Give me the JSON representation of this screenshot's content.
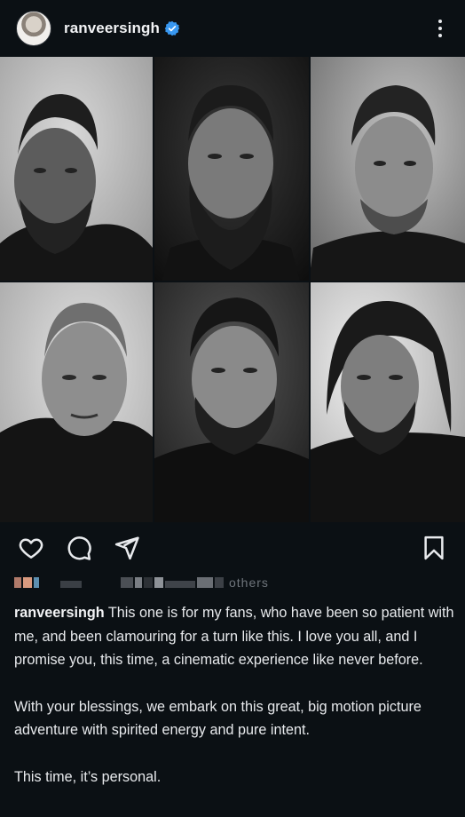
{
  "header": {
    "username": "ranveersingh",
    "verified": true,
    "icons": [
      "avatar",
      "verified-badge-icon",
      "more-options-icon"
    ]
  },
  "grid": {
    "tiles": 6,
    "tone": "black-and-white portraits"
  },
  "actions": {
    "icons": [
      "heart-icon",
      "comment-icon",
      "share-icon",
      "bookmark-icon"
    ]
  },
  "likes": {
    "visible_text": "others"
  },
  "caption": {
    "username": "ranveersingh",
    "p1": "This one is for my fans, who have been so patient with me, and been clamouring for a turn like this. I love you all, and I promise you, this time, a cinematic experience like never before.",
    "p2": "With your blessings, we embark on this great, big motion picture adventure with spirited energy and pure intent.",
    "p3": "This time, it’s personal."
  },
  "colors": {
    "background": "#0b1014",
    "text": "#e8eaed",
    "verified_blue": "#3897f0"
  }
}
